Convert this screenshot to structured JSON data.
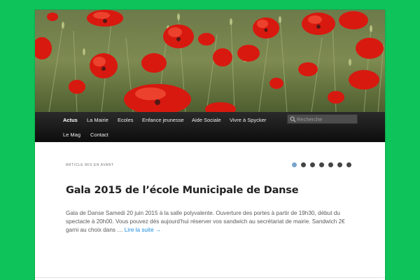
{
  "banner": {
    "image": "red-poppies-field-photo"
  },
  "nav": {
    "items": [
      {
        "label": "Actus",
        "active": true
      },
      {
        "label": "La Mairie"
      },
      {
        "label": "Ecoles"
      },
      {
        "label": "Enfance jeunesse"
      },
      {
        "label": "Aide Sociale"
      },
      {
        "label": "Vivre à Spycker"
      },
      {
        "label": "Le Mag"
      },
      {
        "label": "Contact"
      }
    ],
    "search": {
      "placeholder": "Recherche",
      "icon": "search-icon"
    }
  },
  "featured": {
    "label": "Article mis en avant",
    "slides_total": 7,
    "active_slide": 1,
    "title": "Gala 2015 de l’école Municipale de Danse",
    "excerpt": "Gala de Danse Samedi 20 juin 2015 à la salle polyvalente. Ouverture des portes à partir de 19h30, début du spectacle à 20h00. Vous pouvez dès aujourd’hui réserver vos sandwich au secrétariat de mairie. Sandwich 2€  garni au choix dans …",
    "read_more": "Lire la suite →"
  },
  "colors": {
    "background": "#0dc35a",
    "nav_bg": "#1a1a1a",
    "link": "#1b8be0",
    "active_dot": "#79a4cc"
  }
}
